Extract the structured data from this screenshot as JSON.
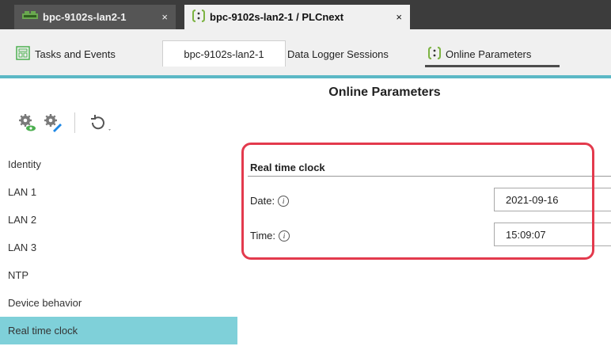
{
  "doc_tabs": [
    {
      "label": "bpc-9102s-lan2-1",
      "icon": "device-icon",
      "close": "×"
    },
    {
      "label": "bpc-9102s-lan2-1 / PLCnext",
      "icon": "plcnext-icon",
      "close": "×"
    }
  ],
  "editor_tabs": [
    {
      "label": "Tasks and Events",
      "icon": "tasks-icon"
    },
    {
      "label": "bpc-9102s-lan2-1"
    },
    {
      "label": "Data Logger Sessions"
    },
    {
      "label": "Online Parameters",
      "icon": "plcnext-icon"
    }
  ],
  "page_title": "Online Parameters",
  "toolbar": {
    "icons": [
      "read-parameters-icon",
      "write-parameters-icon",
      "refresh-icon"
    ]
  },
  "nav": {
    "items": [
      "Identity",
      "LAN 1",
      "LAN 2",
      "LAN 3",
      "NTP",
      "Device behavior",
      "Real time clock"
    ],
    "active_index": 6
  },
  "section": {
    "title": "Real time clock",
    "fields": [
      {
        "label": "Date:",
        "value": "2021-09-16"
      },
      {
        "label": "Time:",
        "value": "15:09:07"
      }
    ]
  },
  "colors": {
    "accent": "#5bb8c5",
    "active_nav": "#7fd0d9",
    "highlight": "#e33a4d"
  }
}
